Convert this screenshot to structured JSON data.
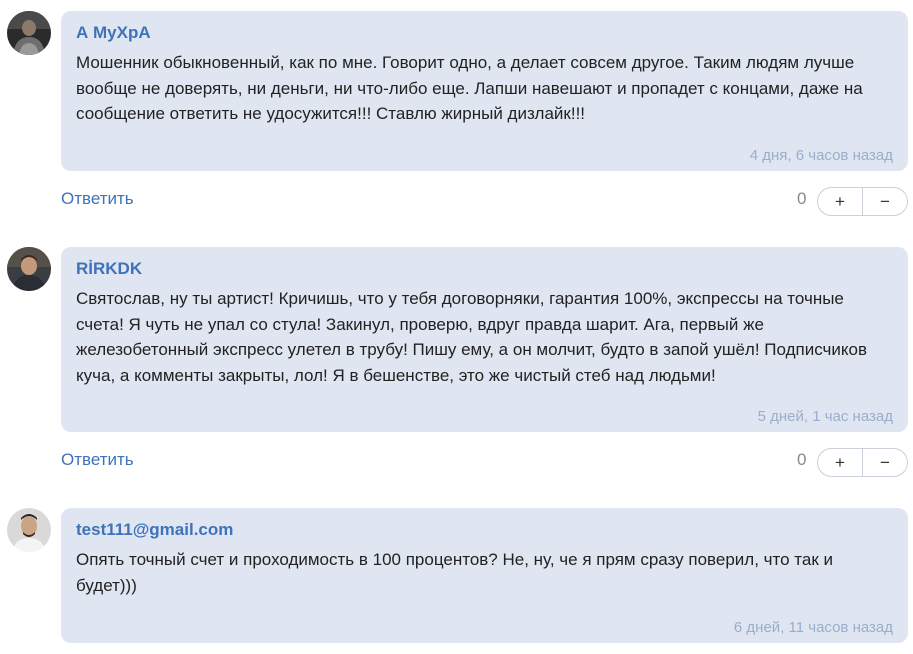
{
  "comments": [
    {
      "author": "А МуХрА",
      "text": "Мошенник обыкновенный, как по мне. Говорит одно, а делает совсем другое. Таким людям лучше вообще не доверять, ни деньги, ни что-либо еще. Лапши навешают и пропадет с концами, даже на сообщение ответить не удосужится!!! Ставлю жирный дизлайк!!!",
      "time": "4 дня, 6 часов назад",
      "reply_label": "Ответить",
      "score": "0",
      "plus": "+",
      "minus": "−"
    },
    {
      "author": "RİRKDK",
      "text": "Святослав, ну ты артист! Кричишь, что у тебя договорняки, гарантия 100%, экспрессы на точные счета! Я чуть не упал со стула! Закинул, проверю, вдруг правда шарит. Ага, первый же железобетонный экспресс улетел в трубу! Пишу ему, а он молчит, будто в запой ушёл! Подписчиков куча, а комменты закрыты, лол! Я в бешенстве, это же чистый стеб над людьми!",
      "time": "5 дней, 1 час назад",
      "reply_label": "Ответить",
      "score": "0",
      "plus": "+",
      "minus": "−"
    },
    {
      "author": "test111@gmail.com",
      "text": "Опять точный счет и проходимость в 100 процентов? Не, ну, че я прям сразу поверил, что так и будет)))",
      "time": "6 дней, 11 часов назад"
    }
  ],
  "colors": {
    "bubble": "#dfe6f1",
    "author": "#3f72b9",
    "time": "#9aadcc"
  }
}
